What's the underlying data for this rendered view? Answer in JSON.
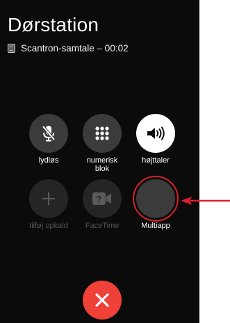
{
  "screen": {
    "title": "Dørstation",
    "call_status": "Scantron-samtale – 00:02"
  },
  "controls": [
    {
      "id": "mute",
      "label": "lydløs",
      "icon": "mic-slash-icon",
      "enabled": true
    },
    {
      "id": "keypad",
      "label": "numerisk blok",
      "icon": "keypad-icon",
      "enabled": true
    },
    {
      "id": "speaker",
      "label": "højttaler",
      "icon": "speaker-icon",
      "enabled": true,
      "active": true
    },
    {
      "id": "add-call",
      "label": "tilføj opkald",
      "icon": "plus-icon",
      "enabled": false
    },
    {
      "id": "facetime",
      "label": "FaceTime",
      "icon": "video-question-icon",
      "enabled": false
    },
    {
      "id": "multiapp",
      "label": "Multiapp",
      "icon": "multiapp-icon",
      "enabled": true,
      "highlighted": true
    }
  ],
  "end_call": {
    "icon": "close-icon",
    "color": "#ef4137"
  },
  "colors": {
    "background": "#0b0b0b",
    "button": "#3b3b3b",
    "active_button": "#ffffff",
    "highlight": "#d9202a"
  }
}
